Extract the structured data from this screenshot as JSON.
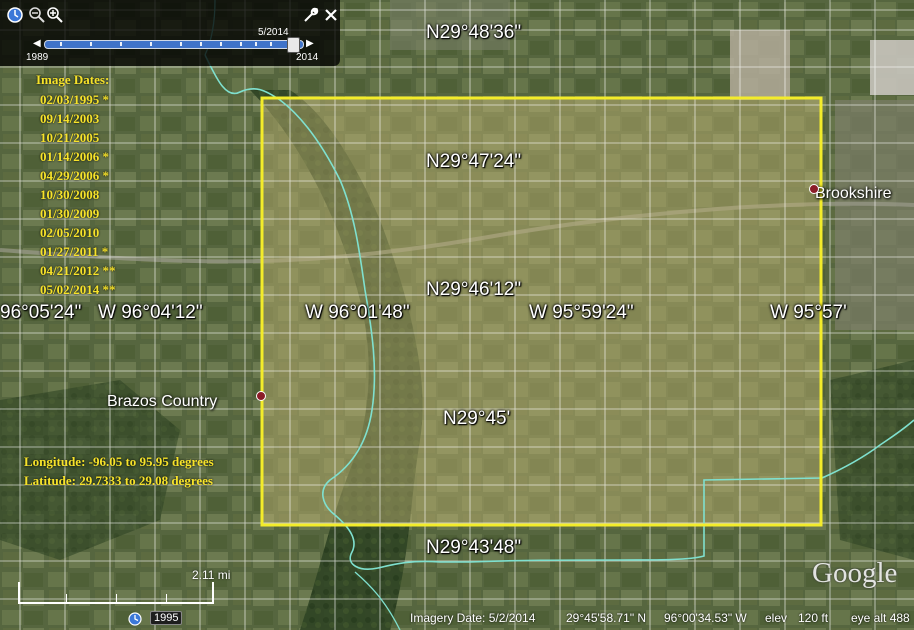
{
  "colors": {
    "box_outline": "#f3ec2a",
    "box_fill": "rgba(196,182,118,0.45)",
    "gridline": "#ffffff",
    "river": "#7fe0cf",
    "overlay_text": "#f7e32a",
    "place_marker": "#8b1c28"
  },
  "toolbar": {
    "icons": [
      "clock-icon",
      "zoom-out-icon",
      "zoom-in-icon",
      "wrench-icon",
      "close-icon"
    ],
    "slider": {
      "current_label": "5/2014",
      "start_label": "1989",
      "end_label": "2014",
      "position_fraction": 0.98
    }
  },
  "overlay": {
    "dates_title": "Image Dates:",
    "dates": [
      "02/03/1995 *",
      "09/14/2003",
      "10/21/2005",
      "01/14/2006 *",
      "04/29/2006 *",
      "10/30/2008",
      "01/30/2009",
      "02/05/2010",
      "01/27/2011 *",
      "04/21/2012 **",
      "05/02/2014 **"
    ],
    "longitude_text": "Longitude: -96.05 to 95.95 degrees",
    "latitude_text": "Latitude: 29.7333 to 29.08 degrees"
  },
  "grid_labels": {
    "lat_1": "N29°48'36\"",
    "lat_2": "N29°47'24\"",
    "lat_3": "N29°46'12\"",
    "lat_4": "N29°45'",
    "lat_5": "N29°43'48\"",
    "lon_1": "96°05'24\"",
    "lon_2": "W 96°04'12\"",
    "lon_3": "W 96°01'48\"",
    "lon_4": "W 95°59'24\"",
    "lon_5": "W 95°57'"
  },
  "places": {
    "brazos": "Brazos Country",
    "brookshire": "Brookshire"
  },
  "scale": {
    "label": "2.11 mi"
  },
  "historical": {
    "year": "1995"
  },
  "status_bar": {
    "imagery_date": "Imagery Date: 5/2/2014",
    "lat": "29°45'58.71\" N",
    "lon": "96°00'34.53\" W",
    "elev_label": "elev",
    "elev_value": "120 ft",
    "eye_alt": "eye alt  488"
  },
  "branding": {
    "logo_text": "Google"
  }
}
